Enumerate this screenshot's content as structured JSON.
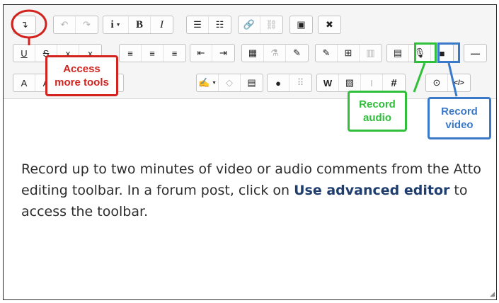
{
  "toolbar": {
    "row1": [
      {
        "name": "show-more-buttons",
        "icon": "↴"
      },
      {
        "name": "undo",
        "icon": "↶"
      },
      {
        "name": "redo",
        "icon": "↷"
      },
      {
        "name": "paragraph-styles",
        "icon": "i"
      },
      {
        "name": "bold",
        "icon": "B"
      },
      {
        "name": "italic",
        "icon": "I"
      },
      {
        "name": "unordered-list",
        "icon": "☰"
      },
      {
        "name": "ordered-list",
        "icon": "☷"
      },
      {
        "name": "link",
        "icon": "🔗"
      },
      {
        "name": "unlink",
        "icon": "⛓"
      },
      {
        "name": "image",
        "icon": "▣"
      },
      {
        "name": "fullscreen",
        "icon": "✖"
      }
    ],
    "row2": [
      {
        "name": "underline",
        "icon": "U"
      },
      {
        "name": "strikethrough",
        "icon": "S"
      },
      {
        "name": "subscript",
        "icon": "x"
      },
      {
        "name": "superscript",
        "icon": "x"
      },
      {
        "name": "align-left",
        "icon": "≡"
      },
      {
        "name": "align-center",
        "icon": "≡"
      },
      {
        "name": "align-right",
        "icon": "≡"
      },
      {
        "name": "outdent",
        "icon": "⇤"
      },
      {
        "name": "indent",
        "icon": "⇥"
      },
      {
        "name": "equation",
        "icon": "▦"
      },
      {
        "name": "chemistry",
        "icon": "⚗"
      },
      {
        "name": "pencil",
        "icon": "✎"
      },
      {
        "name": "edit-table",
        "icon": "✎"
      },
      {
        "name": "table",
        "icon": "⊞"
      },
      {
        "name": "columns",
        "icon": "▥"
      },
      {
        "name": "document",
        "icon": "▤"
      },
      {
        "name": "record-audio",
        "icon": "🎙"
      },
      {
        "name": "record-video",
        "icon": "■"
      },
      {
        "name": "horizontal-rule",
        "icon": "—"
      }
    ],
    "row3": [
      {
        "name": "text-color",
        "icon": "A"
      },
      {
        "name": "font",
        "icon": "A"
      },
      {
        "name": "text-highlight",
        "icon": "✎"
      },
      {
        "name": "background-color",
        "icon": "✎"
      },
      {
        "name": "light",
        "icon": "♀"
      },
      {
        "name": "format",
        "icon": "✍"
      },
      {
        "name": "eraser",
        "icon": "◇"
      },
      {
        "name": "page",
        "icon": "▤"
      },
      {
        "name": "accessibility-checker",
        "icon": "●"
      },
      {
        "name": "screenreader-helper",
        "icon": "⠿"
      },
      {
        "name": "paste-from-word",
        "icon": "W"
      },
      {
        "name": "paste",
        "icon": "▧"
      },
      {
        "name": "cursor",
        "icon": "I"
      },
      {
        "name": "hashtag",
        "icon": "#"
      },
      {
        "name": "target",
        "icon": "⊙"
      },
      {
        "name": "html-source",
        "icon": "</>"
      }
    ]
  },
  "callouts": {
    "access_line1": "Access",
    "access_line2": "more tools",
    "audio_line1": "Record",
    "audio_line2": "audio",
    "video_line1": "Record",
    "video_line2": "video"
  },
  "content": {
    "text_before": "Record up to two minutes of video or audio comments from the Atto editing toolbar. In a forum post, click on ",
    "link_text": "Use advanced editor",
    "text_after": " to access the toolbar."
  },
  "colors": {
    "access": "#d2231f",
    "audio": "#2fbf3b",
    "video": "#3a79c9"
  }
}
